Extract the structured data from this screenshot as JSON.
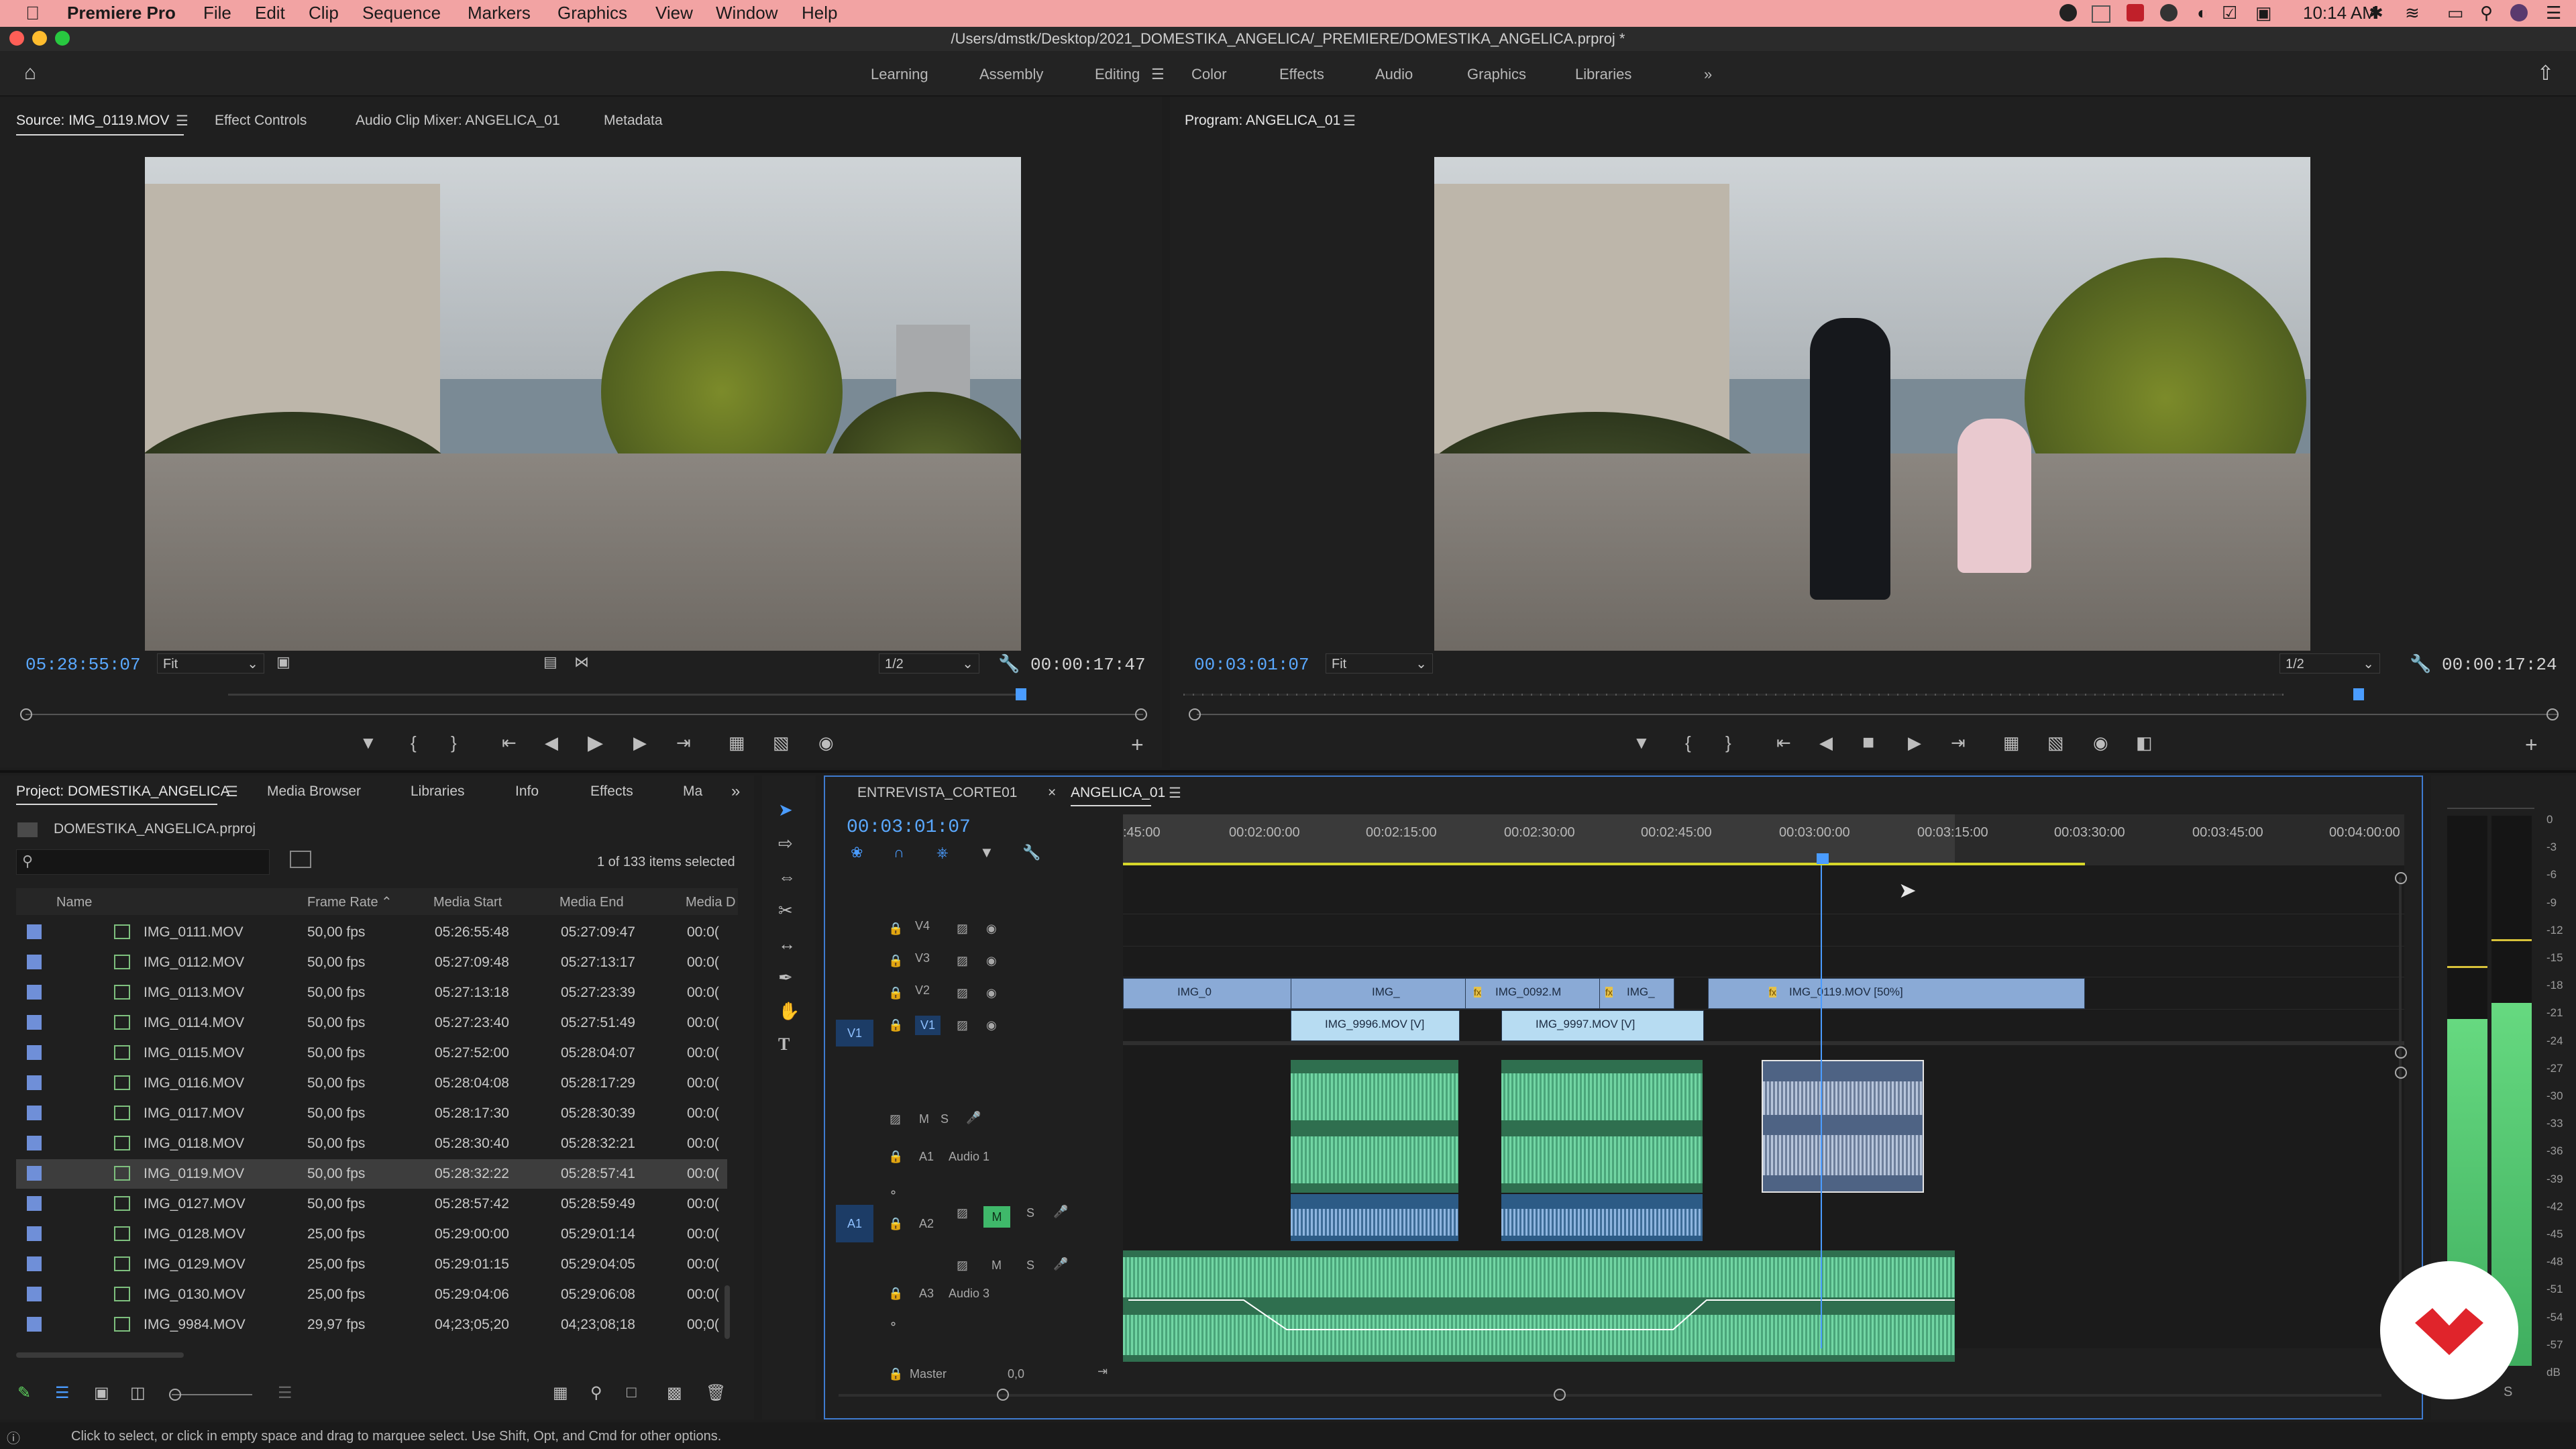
{
  "menubar": {
    "app": "Premiere Pro",
    "items": [
      "File",
      "Edit",
      "Clip",
      "Sequence",
      "Markers",
      "Graphics",
      "View",
      "Window",
      "Help"
    ],
    "time": "10:14 AM"
  },
  "titlebar": {
    "path": "/Users/dmstk/Desktop/2021_DOMESTIKA_ANGELICA/_PREMIERE/DOMESTIKA_ANGELICA.prproj *"
  },
  "workspaces": {
    "items": [
      "Learning",
      "Assembly",
      "Editing",
      "Color",
      "Effects",
      "Audio",
      "Graphics",
      "Libraries"
    ],
    "active": "Editing"
  },
  "source": {
    "tabs": [
      "Source: IMG_0119.MOV",
      "Effect Controls",
      "Audio Clip Mixer: ANGELICA_01",
      "Metadata"
    ],
    "timecode": "05:28:55:07",
    "fit": "Fit",
    "resolution": "1/2",
    "duration": "00:00:17:47"
  },
  "program": {
    "tab": "Program: ANGELICA_01",
    "timecode": "00:03:01:07",
    "fit": "Fit",
    "resolution": "1/2",
    "duration": "00:00:17:24"
  },
  "project": {
    "tabs": [
      "Project: DOMESTIKA_ANGELICA",
      "Media Browser",
      "Libraries",
      "Info",
      "Effects",
      "Ma"
    ],
    "file": "DOMESTIKA_ANGELICA.prproj",
    "selection": "1 of 133 items selected",
    "columns": [
      "Name",
      "Frame Rate",
      "Media Start",
      "Media End",
      "Media D"
    ],
    "rows": [
      {
        "name": "IMG_0111.MOV",
        "fps": "50,00 fps",
        "start": "05:26:55:48",
        "end": "05:27:09:47",
        "dur": "00:0("
      },
      {
        "name": "IMG_0112.MOV",
        "fps": "50,00 fps",
        "start": "05:27:09:48",
        "end": "05:27:13:17",
        "dur": "00:0("
      },
      {
        "name": "IMG_0113.MOV",
        "fps": "50,00 fps",
        "start": "05:27:13:18",
        "end": "05:27:23:39",
        "dur": "00:0("
      },
      {
        "name": "IMG_0114.MOV",
        "fps": "50,00 fps",
        "start": "05:27:23:40",
        "end": "05:27:51:49",
        "dur": "00:0("
      },
      {
        "name": "IMG_0115.MOV",
        "fps": "50,00 fps",
        "start": "05:27:52:00",
        "end": "05:28:04:07",
        "dur": "00:0("
      },
      {
        "name": "IMG_0116.MOV",
        "fps": "50,00 fps",
        "start": "05:28:04:08",
        "end": "05:28:17:29",
        "dur": "00:0("
      },
      {
        "name": "IMG_0117.MOV",
        "fps": "50,00 fps",
        "start": "05:28:17:30",
        "end": "05:28:30:39",
        "dur": "00:0("
      },
      {
        "name": "IMG_0118.MOV",
        "fps": "50,00 fps",
        "start": "05:28:30:40",
        "end": "05:28:32:21",
        "dur": "00:0("
      },
      {
        "name": "IMG_0119.MOV",
        "fps": "50,00 fps",
        "start": "05:28:32:22",
        "end": "05:28:57:41",
        "dur": "00:0("
      },
      {
        "name": "IMG_0127.MOV",
        "fps": "50,00 fps",
        "start": "05:28:57:42",
        "end": "05:28:59:49",
        "dur": "00:0("
      },
      {
        "name": "IMG_0128.MOV",
        "fps": "25,00 fps",
        "start": "05:29:00:00",
        "end": "05:29:01:14",
        "dur": "00:0("
      },
      {
        "name": "IMG_0129.MOV",
        "fps": "25,00 fps",
        "start": "05:29:01:15",
        "end": "05:29:04:05",
        "dur": "00:0("
      },
      {
        "name": "IMG_0130.MOV",
        "fps": "25,00 fps",
        "start": "05:29:04:06",
        "end": "05:29:06:08",
        "dur": "00:0("
      },
      {
        "name": "IMG_9984.MOV",
        "fps": "29,97 fps",
        "start": "04;23;05;20",
        "end": "04;23;08;18",
        "dur": "00;0("
      }
    ],
    "selected_index": 8
  },
  "timeline": {
    "tabs": [
      "ENTREVISTA_CORTE01",
      "ANGELICA_01"
    ],
    "timecode": "00:03:01:07",
    "ruler": [
      ":45:00",
      "00:02:00:00",
      "00:02:15:00",
      "00:02:30:00",
      "00:02:45:00",
      "00:03:00:00",
      "00:03:15:00",
      "00:03:30:00",
      "00:03:45:00",
      "00:04:00:00"
    ],
    "video_tracks": [
      "V4",
      "V3",
      "V2",
      "V1"
    ],
    "audio_tracks": [
      "A1",
      "A2",
      "A3"
    ],
    "audio_names": {
      "a1": "Audio 1",
      "a3": "Audio 3"
    },
    "master": {
      "label": "Master",
      "value": "0,0"
    },
    "v2_clips": [
      "IMG_0",
      "IMG_",
      "IMG_0092.M",
      "IMG_",
      "IMG_0119.MOV [50%]"
    ],
    "v1_clips": [
      "IMG_9996.MOV [V]",
      "IMG_9997.MOV [V]"
    ],
    "src_v1": "V1",
    "src_a1": "A1",
    "toggle_m": "M",
    "toggle_s": "S"
  },
  "meters": {
    "scale": [
      "0",
      "-3",
      "-6",
      "-9",
      "-12",
      "-15",
      "-18",
      "-21",
      "-24",
      "-27",
      "-30",
      "-33",
      "-36",
      "-39",
      "-42",
      "-45",
      "-48",
      "-51",
      "-54",
      "-57",
      "dB"
    ],
    "levels": [
      0.63,
      0.66
    ],
    "solo": "S"
  },
  "status": {
    "text": "Click to select, or click in empty space and drag to marquee select. Use Shift, Opt, and Cmd for other options."
  },
  "colors": {
    "accent": "#4a9cff",
    "video_clip": "#9db8df",
    "video_clip_light": "#b8dcf2",
    "audio_clip": "#2f8a5c",
    "menubar": "#f2a3a3"
  }
}
